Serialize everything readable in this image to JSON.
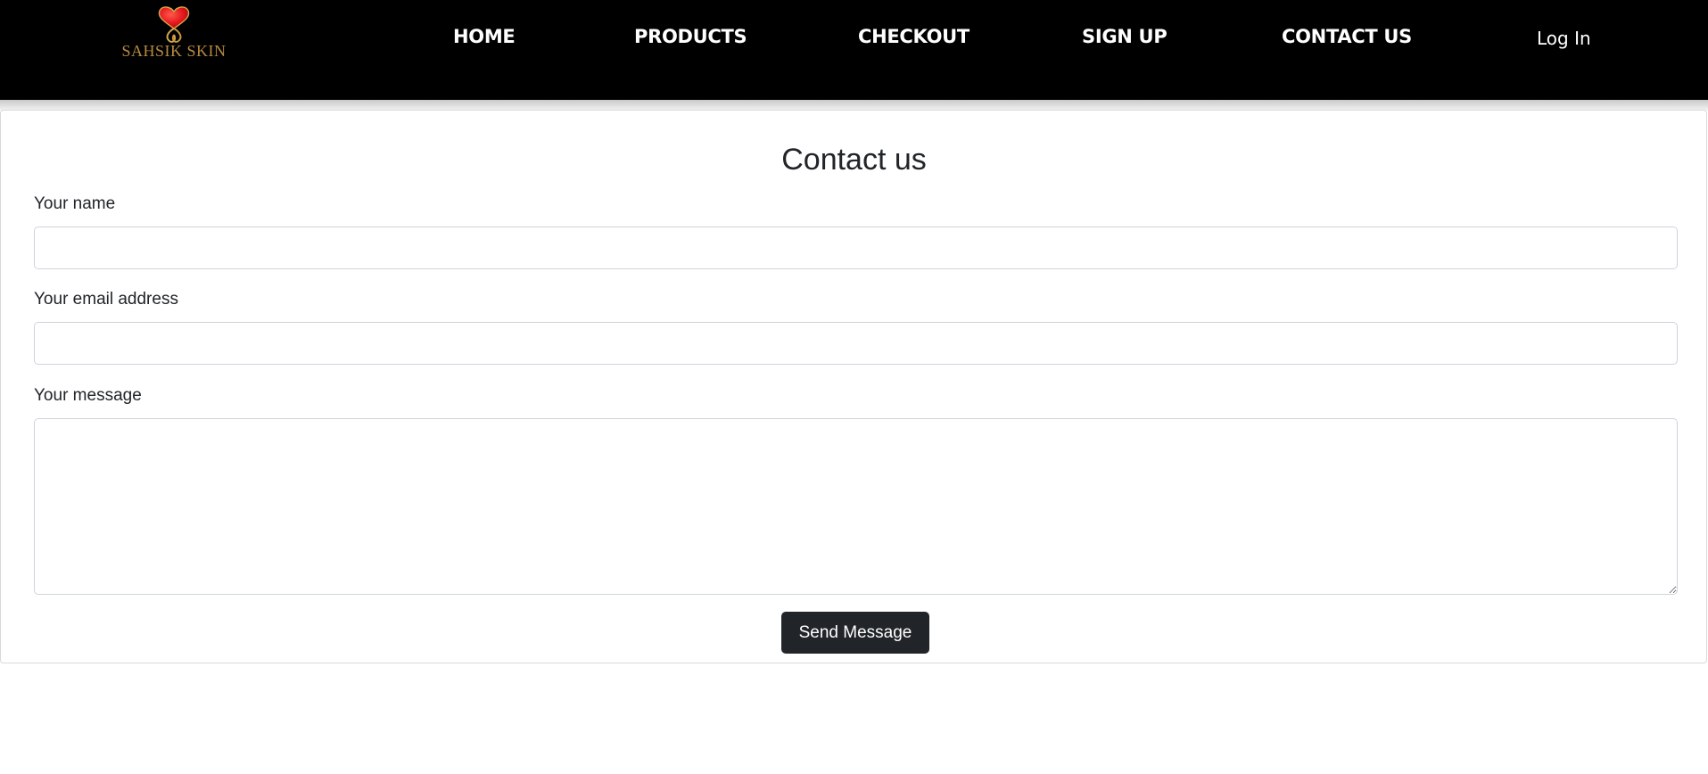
{
  "brand": {
    "name": "SAHSIK SKIN",
    "logo_icon": "heart-ribbon-logo",
    "colors": {
      "heart": "#e5161c",
      "gold": "#b78a3e"
    }
  },
  "nav": {
    "items": [
      {
        "label": "HOME"
      },
      {
        "label": "PRODUCTS"
      },
      {
        "label": "CHECKOUT"
      },
      {
        "label": "SIGN UP"
      },
      {
        "label": "CONTACT US"
      }
    ],
    "login_label": "Log In"
  },
  "contact_form": {
    "title": "Contact us",
    "name_label": "Your name",
    "name_value": "",
    "email_label": "Your email address",
    "email_value": "",
    "message_label": "Your message",
    "message_value": "",
    "submit_label": "Send Message"
  },
  "colors": {
    "navbar_bg": "#000000",
    "button_bg": "#212529",
    "text": "#212529"
  }
}
